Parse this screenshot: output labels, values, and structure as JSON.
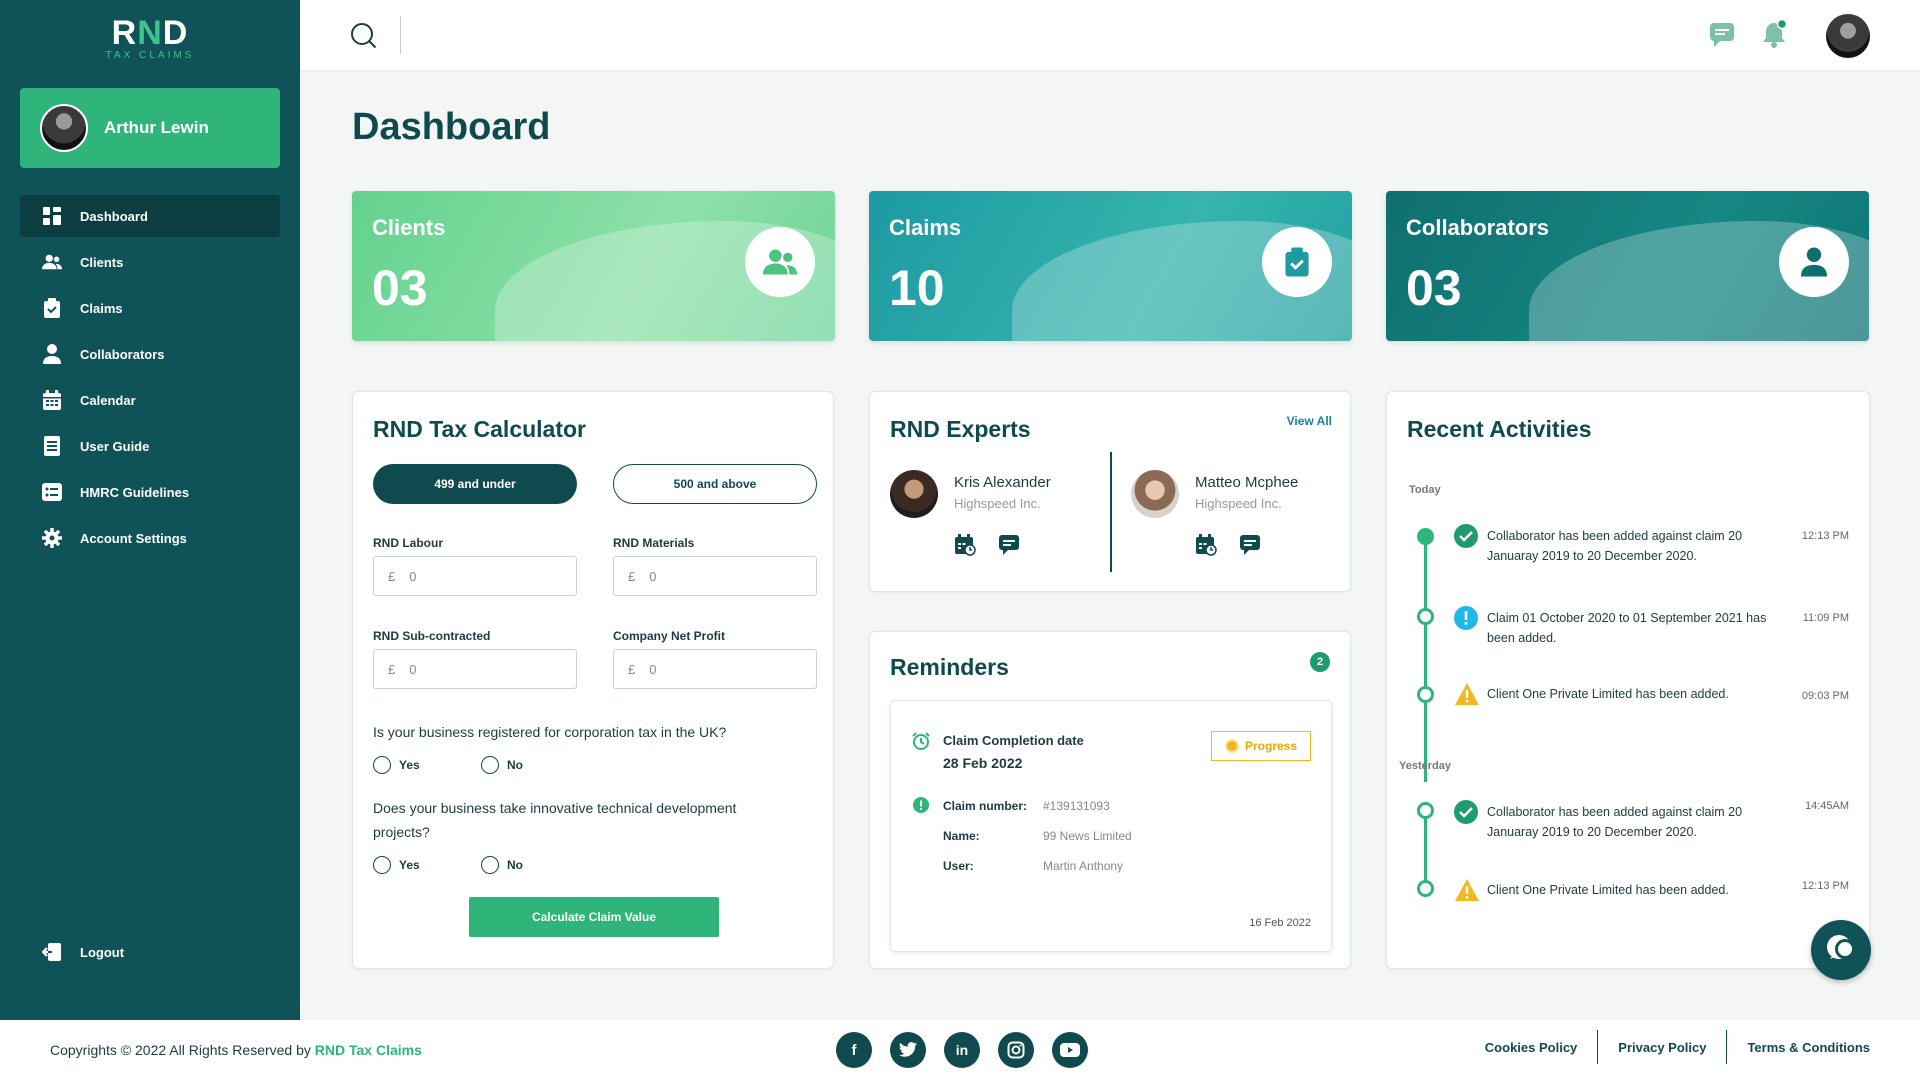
{
  "logo": {
    "main_a": "R",
    "main_b": "N",
    "main_c": "D",
    "sub": "TAX CLAIMS"
  },
  "user": {
    "name": "Arthur Lewin"
  },
  "nav": [
    {
      "label": "Dashboard",
      "icon": "grid-icon"
    },
    {
      "label": "Clients",
      "icon": "users-icon"
    },
    {
      "label": "Claims",
      "icon": "clipboard-icon"
    },
    {
      "label": "Collaborators",
      "icon": "user-icon"
    },
    {
      "label": "Calendar",
      "icon": "calendar-icon"
    },
    {
      "label": "User Guide",
      "icon": "book-icon"
    },
    {
      "label": "HMRC Guidelines",
      "icon": "list-icon"
    },
    {
      "label": "Account Settings",
      "icon": "gear-icon"
    }
  ],
  "logout": "Logout",
  "page_title": "Dashboard",
  "stats": [
    {
      "label": "Clients",
      "value": "03",
      "color_a": "#63d28e",
      "color_b": "#8fe0a8",
      "icon": "users-icon"
    },
    {
      "label": "Claims",
      "value": "10",
      "color_a": "#1d9aa2",
      "color_b": "#36b4ad",
      "icon": "clipboard-check-icon"
    },
    {
      "label": "Collaborators",
      "value": "03",
      "color_a": "#0f6f70",
      "color_b": "#168784",
      "icon": "user-icon"
    }
  ],
  "calculator": {
    "title": "RND Tax Calculator",
    "opt_a": "499 and under",
    "opt_b": "500 and above",
    "labour_label": "RND Labour",
    "materials_label": "RND Materials",
    "subcontracted_label": "RND Sub-contracted",
    "net_profit_label": "Company Net Profit",
    "currency": "£",
    "field_value": "0",
    "q1": "Is your business registered for corporation tax in the UK?",
    "q2": "Does your business take innovative technical development projects?",
    "yes": "Yes",
    "no": "No",
    "button": "Calculate Claim Value"
  },
  "experts": {
    "title": "RND Experts",
    "view_all": "View All",
    "items": [
      {
        "name": "Kris Alexander",
        "company": "Highspeed Inc."
      },
      {
        "name": "Matteo Mcphee",
        "company": "Highspeed Inc."
      }
    ]
  },
  "reminders": {
    "title": "Reminders",
    "count": "2",
    "item": {
      "title": "Claim Completion date",
      "date": "28 Feb 2022",
      "status": "Progress",
      "claim_label": "Claim number:",
      "claim_value": "#139131093",
      "name_label": "Name:",
      "name_value": "99 News Limited",
      "user_label": "User:",
      "user_value": "Martin Anthony",
      "footer_date": "16 Feb 2022"
    }
  },
  "activities": {
    "title": "Recent Activities",
    "today": "Today",
    "yesterday": "Yesterday",
    "items": [
      {
        "text": "Collaborator has been added against claim 20 Januaray 2019 to 20 December 2020.",
        "time": "12:13 PM",
        "status": "success"
      },
      {
        "text": "Claim 01 October 2020 to 01 September 2021 has been added.",
        "time": "11:09 PM",
        "status": "info"
      },
      {
        "text": "Client One Private Limited has been added.",
        "time": "09:03 PM",
        "status": "warning"
      },
      {
        "text": "Collaborator has been added against claim 20 Januaray 2019 to 20 December 2020.",
        "time": "14:45AM",
        "status": "success"
      },
      {
        "text": "Client One Private Limited has been added.",
        "time": "12:13 PM",
        "status": "warning"
      }
    ]
  },
  "footer": {
    "copyright": "Copyrights © 2022 All Rights Reserved by ",
    "brand": "RND Tax Claims",
    "links": [
      "Cookies Policy",
      "Privacy Policy",
      "Terms & Conditions"
    ],
    "socials": [
      "facebook-icon",
      "twitter-icon",
      "linkedin-icon",
      "instagram-icon",
      "youtube-icon"
    ]
  },
  "colors": {
    "primary": "#0f5257",
    "accent": "#2fb57a",
    "warning": "#f0b922",
    "info": "#1fb8e8"
  }
}
